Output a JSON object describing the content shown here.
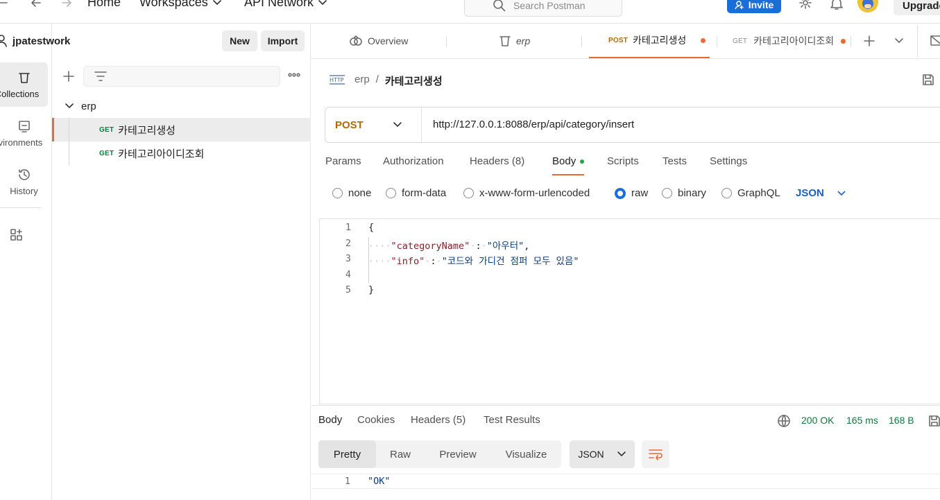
{
  "topbar": {
    "home": "Home",
    "workspaces": "Workspaces",
    "api_network": "API Network",
    "search_placeholder": "Search Postman",
    "invite": "Invite",
    "upgrade": "Upgrade"
  },
  "rail": {
    "collections": "Collections",
    "environments": "Environments",
    "history": "History"
  },
  "sidebar": {
    "workspace": "jpatestwork",
    "new_btn": "New",
    "import_btn": "Import",
    "collection": "erp",
    "requests": [
      {
        "method": "GET",
        "name": "카테고리생성"
      },
      {
        "method": "GET",
        "name": "카테고리아이디조회"
      }
    ]
  },
  "tabs": {
    "overview": "Overview",
    "erp": "erp",
    "tab1_method": "POST",
    "tab1_name": "카테고리생성",
    "tab2_method": "GET",
    "tab2_name": "카테고리아이디조회"
  },
  "request": {
    "breadcrumb_parent": "erp",
    "breadcrumb_sep": "/",
    "title": "카테고리생성",
    "method": "POST",
    "url": "http://127.0.0.1:8088/erp/api/category/insert",
    "tabs": {
      "params": "Params",
      "authorization": "Authorization",
      "headers": "Headers (8)",
      "body": "Body",
      "scripts": "Scripts",
      "tests": "Tests",
      "settings": "Settings"
    },
    "body_types": {
      "none": "none",
      "form_data": "form-data",
      "urlencoded": "x-www-form-urlencoded",
      "raw": "raw",
      "binary": "binary",
      "graphql": "GraphQL",
      "format": "JSON"
    },
    "line_numbers": [
      "1",
      "2",
      "3",
      "4",
      "5"
    ],
    "code": {
      "open": "{",
      "k1": "\"categoryName\"",
      "v1": "\"아우터\"",
      "k2": "\"info\"",
      "v2": "\"코드와 가디건 점퍼 모두 있음\"",
      "close": "}"
    }
  },
  "response": {
    "tabs": {
      "body": "Body",
      "cookies": "Cookies",
      "headers": "Headers (5)",
      "test_results": "Test Results"
    },
    "status": "200 OK",
    "time": "165 ms",
    "size": "168 B",
    "views": {
      "pretty": "Pretty",
      "raw": "Raw",
      "preview": "Preview",
      "visualize": "Visualize",
      "format": "JSON"
    },
    "line1": "1",
    "body": "\"OK\""
  },
  "colors": {
    "accent_orange": "#e86a34",
    "invite_blue": "#1a6ed8",
    "status_green": "#0f7a3c",
    "post_color": "#b06a00"
  }
}
